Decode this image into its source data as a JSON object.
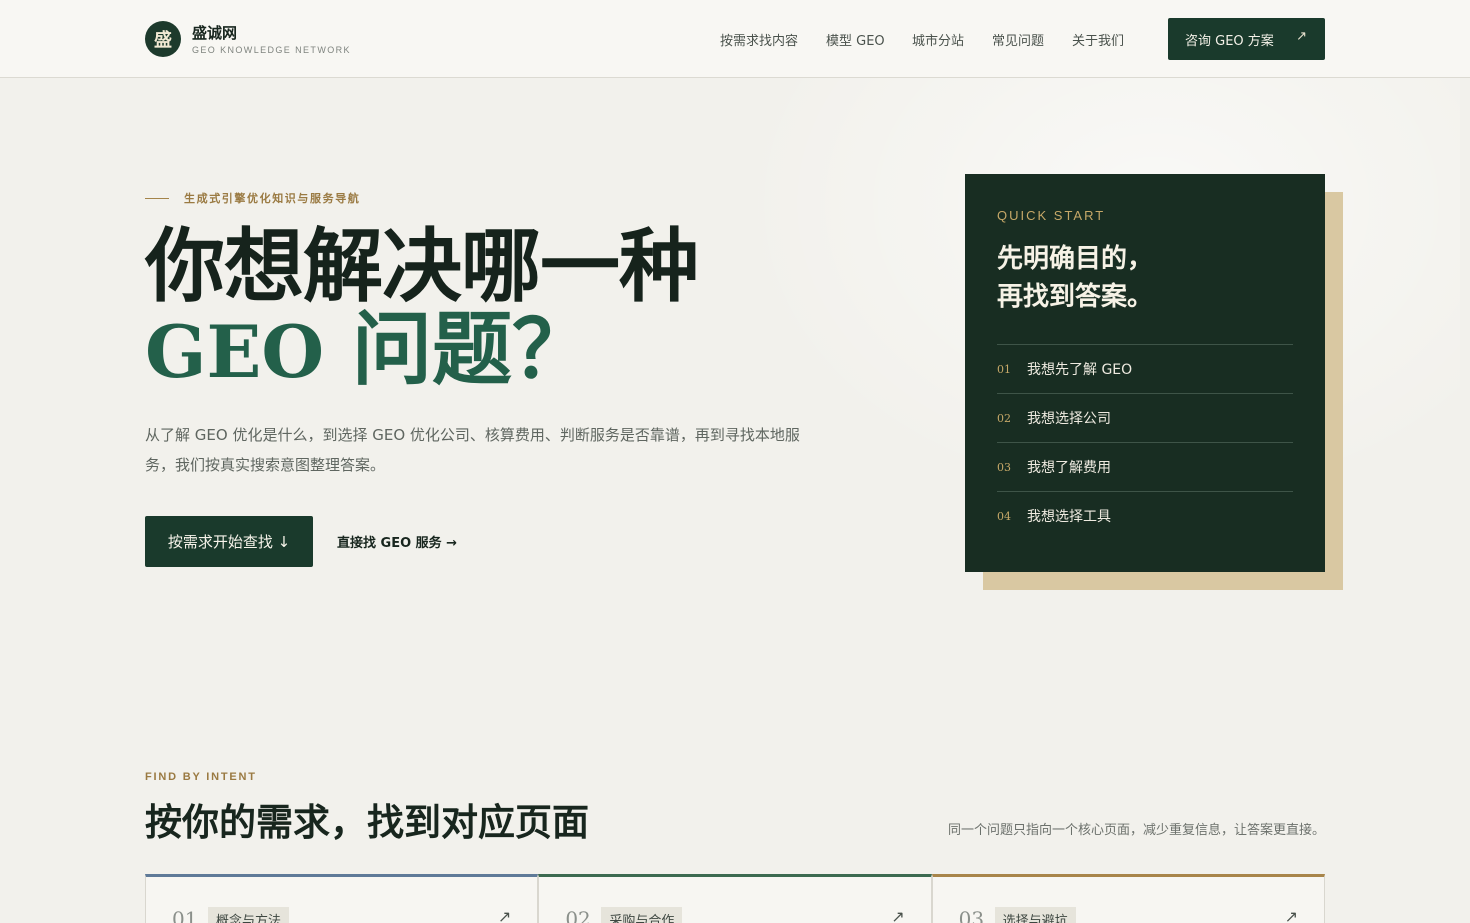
{
  "brand": {
    "logo_char": "盛",
    "name": "盛诚网",
    "tagline": "GEO KNOWLEDGE NETWORK"
  },
  "nav": {
    "items": [
      "按需求找内容",
      "模型 GEO",
      "城市分站",
      "常见问题",
      "关于我们"
    ],
    "cta_label": "咨询 GEO 方案",
    "cta_icon": "↗"
  },
  "hero": {
    "eyebrow": "生成式引擎优化知识与服务导航",
    "headline_line1": "你想解决哪一种",
    "headline_latin": "GEO",
    "headline_rest": " 问题？",
    "description": "从了解 GEO 优化是什么，到选择 GEO 优化公司、核算费用、判断服务是否靠谱，再到寻找本地服务，我们按真实搜索意图整理答案。",
    "primary_button": "按需求开始查找 ↓",
    "secondary_link": "直接找 GEO 服务 →"
  },
  "quick_start": {
    "label": "QUICK START",
    "title": "先明确目的，\n再找到答案。",
    "items": [
      {
        "num": "01",
        "text": "我想先了解 GEO"
      },
      {
        "num": "02",
        "text": "我想选择公司"
      },
      {
        "num": "03",
        "text": "我想了解费用"
      },
      {
        "num": "04",
        "text": "我想选择工具"
      }
    ]
  },
  "intent_section": {
    "eyebrow": "FIND BY INTENT",
    "title": "按你的需求，找到对应页面",
    "note": "同一个问题只指向一个核心页面，减少重复信息，让答案更直接。",
    "cards": [
      {
        "num": "01",
        "tag": "概念与方法",
        "accent": "#5f7a98",
        "icon": "↗"
      },
      {
        "num": "02",
        "tag": "采购与合作",
        "accent": "#3c6a50",
        "icon": "↗"
      },
      {
        "num": "03",
        "tag": "选择与避坑",
        "accent": "#a8854a",
        "icon": "↗"
      }
    ]
  },
  "colors": {
    "primary": "#1a3a2c",
    "accent_gold": "#c6a868",
    "headline_green": "#23604a",
    "background": "#f2f1ec"
  }
}
